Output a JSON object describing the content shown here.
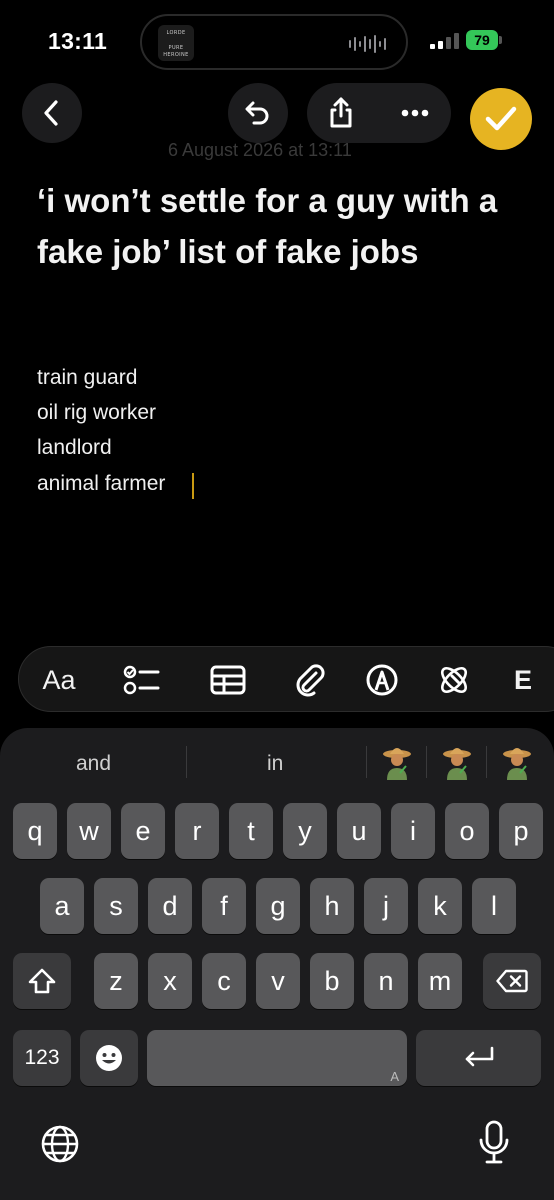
{
  "status_bar": {
    "time": "13:11",
    "album_text_1": "LORDE",
    "album_text_2": "PURE HEROINE",
    "battery": "79"
  },
  "toolbar": {
    "back_icon": "chevron-left-icon",
    "undo_icon": "undo-icon",
    "share_icon": "share-icon",
    "more_icon": "ellipsis-icon",
    "done_icon": "checkmark-icon",
    "done_color": "#e6b422"
  },
  "note": {
    "date": "6 August 2026 at 13:11",
    "title": "‘i won’t settle for a guy with a fake job’ list of fake jobs",
    "lines": [
      "train guard",
      "oil rig worker",
      "landlord",
      "animal farmer"
    ]
  },
  "format_bar": {
    "text_style_label": "Aa",
    "icons": [
      "checklist-icon",
      "table-icon",
      "paperclip-icon",
      "markup-pen-icon",
      "writing-tools-icon",
      "more-icon"
    ],
    "partial_label": "E"
  },
  "keyboard": {
    "suggestions": [
      "and",
      "in"
    ],
    "emoji_suggestions": [
      "farmer-emoji",
      "farmer-emoji",
      "farmer-emoji"
    ],
    "row1": [
      "q",
      "w",
      "e",
      "r",
      "t",
      "y",
      "u",
      "i",
      "o",
      "p"
    ],
    "row2": [
      "a",
      "s",
      "d",
      "f",
      "g",
      "h",
      "j",
      "k",
      "l"
    ],
    "row3": [
      "z",
      "x",
      "c",
      "v",
      "b",
      "n",
      "m"
    ],
    "numbers_label": "123",
    "space_corner_label": "A",
    "bottom_icons": [
      "globe-icon",
      "microphone-icon"
    ],
    "function_icons": [
      "shift-icon",
      "delete-icon",
      "emoji-icon",
      "return-icon"
    ]
  }
}
